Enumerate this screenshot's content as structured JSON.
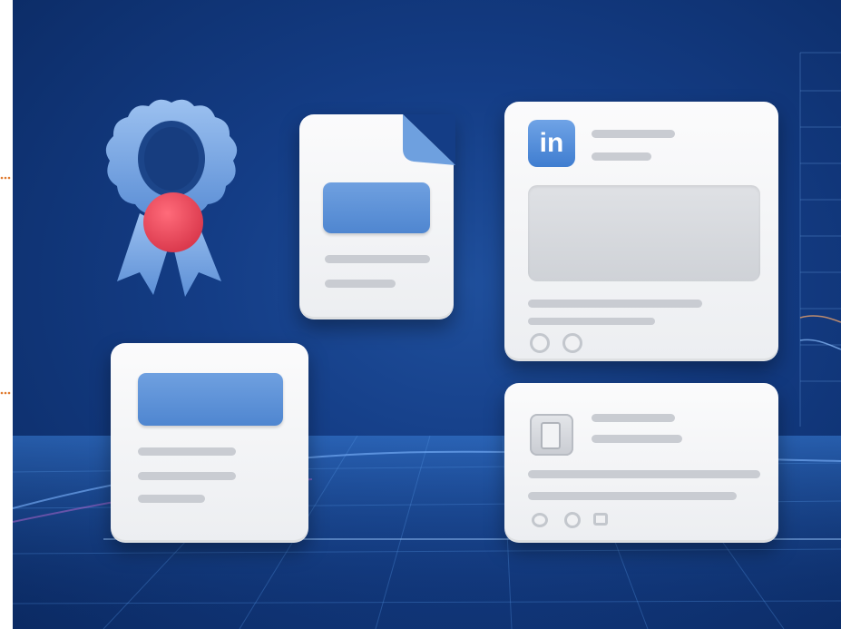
{
  "profile_card": {
    "logo_text": "in"
  },
  "colors": {
    "accent_blue": "#4f86d0",
    "ribbon_seal_red": "#e9475a",
    "connector_orange": "#e07a2e",
    "background_navy": "#143d86"
  },
  "icons": [
    "award-ribbon-icon",
    "document-icon",
    "linkedin-logo-icon",
    "profile-photo-icon"
  ]
}
